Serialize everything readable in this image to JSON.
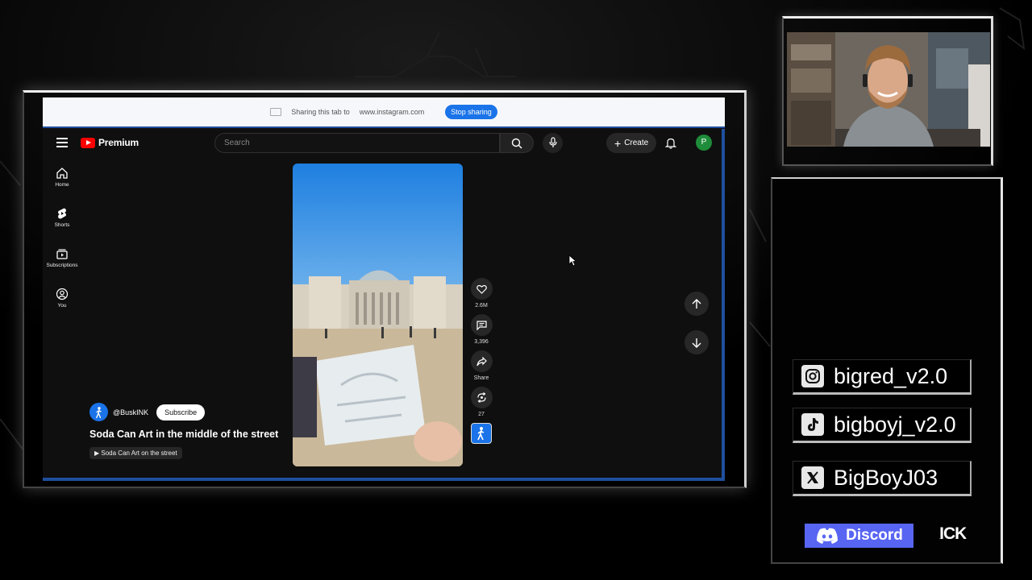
{
  "share_bar": {
    "message": "Sharing this tab to",
    "url": "www.instagram.com",
    "stop_button": "Stop sharing"
  },
  "youtube": {
    "logo_text": "Premium",
    "search_placeholder": "Search",
    "create_label": "Create",
    "avatar_letter": "P",
    "sidebar": [
      {
        "label": "Home",
        "icon": "home-icon"
      },
      {
        "label": "Shorts",
        "icon": "shorts-icon"
      },
      {
        "label": "Subscriptions",
        "icon": "subscriptions-icon"
      },
      {
        "label": "You",
        "icon": "you-icon"
      }
    ],
    "short": {
      "likes": "2.6M",
      "comments": "3,396",
      "share_label": "Share",
      "remix_count": "27",
      "channel_handle": "@BuskINK",
      "subscribe_label": "Subscribe",
      "title": "Soda Can Art in the middle of the street",
      "playlist": "Soda Can Art on the street"
    }
  },
  "socials": {
    "instagram": "bigred_v2.0",
    "tiktok": "bigboyj_v2.0",
    "x": "BigBoyJ03",
    "discord": "Discord",
    "kick": "KICK"
  },
  "colors": {
    "accent_blue": "#1a73e8",
    "youtube_red": "#ff0000",
    "discord_blurple": "#5865f2",
    "frame_blue": "#1f4f9e"
  }
}
